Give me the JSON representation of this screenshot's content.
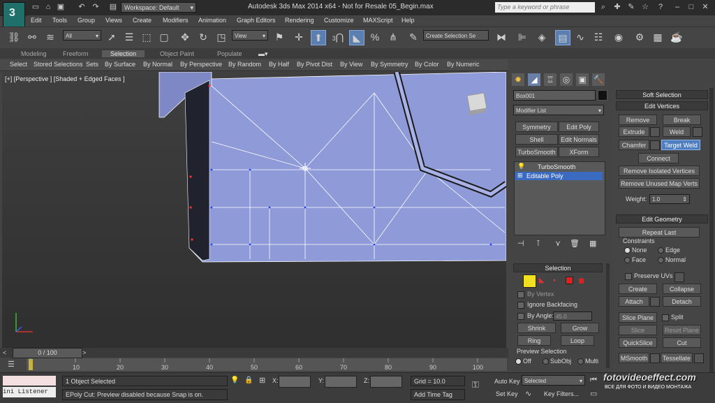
{
  "app": {
    "logo_letter": "3",
    "workspace": "Workspace: Default",
    "title": "Autodesk 3ds Max  2014 x64  - Not for Resale   05_Begin.max",
    "search_placeholder": "Type a keyword or phrase"
  },
  "menu": [
    "Edit",
    "Tools",
    "Group",
    "Views",
    "Create",
    "Modifiers",
    "Animation",
    "Graph Editors",
    "Rendering",
    "Customize",
    "MAXScript",
    "Help"
  ],
  "toolbar": {
    "filter": "All",
    "view": "View",
    "snap_3": "3",
    "selection_set": "Create Selection Se"
  },
  "ribbon_tabs": [
    "Modeling",
    "Freeform",
    "Selection",
    "Object Paint",
    "Populate"
  ],
  "ribbon_active_tab": "Selection",
  "ribbon_buttons": [
    "Select",
    "Stored Selections",
    "Sets",
    "By Surface",
    "By Normal",
    "By Perspective",
    "By Random",
    "By Half",
    "By Pivot Dist",
    "By View",
    "By Symmetry",
    "By Color",
    "By Numeric"
  ],
  "viewport": {
    "label": "[+] [Perspective ] [Shaded + Edged Faces ]",
    "bg_color": "#3d3d3d",
    "mesh_color": "#8f9bd9"
  },
  "timeline": {
    "slider": "0 / 100",
    "ticks": [
      "10",
      "20",
      "30",
      "40",
      "50",
      "60",
      "70",
      "80",
      "90",
      "100"
    ]
  },
  "status": {
    "listener": "ini Listener",
    "objects_selected": "1 Object Selected",
    "prompt": "EPoly Cut: Preview disabled because Snap is on.",
    "x_label": "X:",
    "y_label": "Y:",
    "z_label": "Z:",
    "grid": "Grid = 10.0",
    "add_time_tag": "Add Time Tag",
    "auto_key": "Auto Key",
    "selected": "Selected",
    "set_key": "Set Key",
    "key_filters": "Key Filters..."
  },
  "command_panel": {
    "object_name": "Box001",
    "modifier_list": "Modifier List",
    "mod_buttons": [
      "Symmetry",
      "Edit Poly",
      "Shell",
      "Edit Normals",
      "TurboSmooth",
      "XForm"
    ],
    "stack": [
      "TurboSmooth",
      "Editable Poly"
    ],
    "selection": {
      "header": "Selection",
      "by_vertex": "By Vertex",
      "ignore_backfacing": "Ignore Backfacing",
      "by_angle": "By Angle:",
      "angle_value": "45.0",
      "shrink": "Shrink",
      "grow": "Grow",
      "ring": "Ring",
      "loop": "Loop",
      "preview_selection": "Preview Selection",
      "preview_options": [
        "Off",
        "SubObj",
        "Multi"
      ]
    }
  },
  "rollouts": {
    "soft_selection": "Soft Selection",
    "edit_vertices": {
      "header": "Edit Vertices",
      "remove": "Remove",
      "break": "Break",
      "extrude": "Extrude",
      "weld": "Weld",
      "chamfer": "Chamfer",
      "target_weld": "Target Weld",
      "connect": "Connect",
      "remove_isolated": "Remove Isolated Vertices",
      "remove_unused": "Remove Unused Map Verts",
      "weight_label": "Weight:",
      "weight_value": "1.0"
    },
    "edit_geometry": {
      "header": "Edit Geometry",
      "repeat_last": "Repeat Last",
      "constraints": "Constraints",
      "constraint_options": [
        "None",
        "Edge",
        "Face",
        "Normal"
      ],
      "preserve_uvs": "Preserve UVs",
      "create": "Create",
      "collapse": "Collapse",
      "attach": "Attach",
      "detach": "Detach",
      "slice_plane": "Slice Plane",
      "split": "Split",
      "slice": "Slice",
      "reset_plane": "Reset Plane",
      "quickslice": "QuickSlice",
      "cut": "Cut",
      "msmooth": "MSmooth",
      "tessellate": "Tessellate"
    }
  },
  "watermark": {
    "site": "fotovideoeffect.com",
    "tagline": "ВСЕ ДЛЯ ФОТО И ВИДЕО МОНТАЖА"
  }
}
